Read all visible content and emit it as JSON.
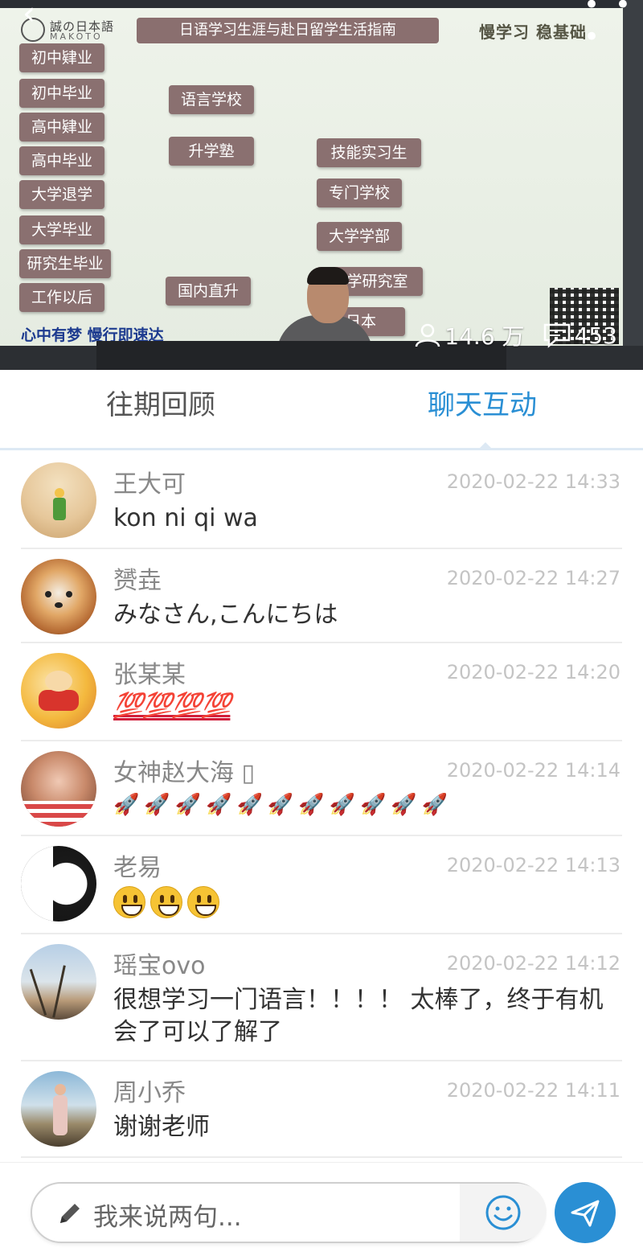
{
  "video": {
    "logo_jp": "誠の日本語",
    "logo_en": "MAKOTO",
    "slide_title": "日语学习生涯与赴日留学生活指南",
    "slide_slogan": "慢学习 稳基础",
    "left_boxes": [
      "初中肄业",
      "初中毕业",
      "高中肄业",
      "高中毕业",
      "大学退学",
      "大学毕业",
      "研究生毕业",
      "工作以后"
    ],
    "middle_boxes": [
      "语言学校",
      "升学塾",
      "国内直升"
    ],
    "right_boxes": [
      "技能实习生",
      "专门学校",
      "大学学部",
      "大学研究室",
      "日本"
    ],
    "motto": "心中有梦  慢行即速达",
    "viewers": "14.6 万",
    "comments": "453"
  },
  "tabs": {
    "history": "往期回顾",
    "chat": "聊天互动",
    "active": "chat"
  },
  "messages": [
    {
      "name": "王大可",
      "time": "2020-02-22 14:33",
      "text": "kon ni qi wa"
    },
    {
      "name": "赟垚",
      "time": "2020-02-22 14:27",
      "text": "みなさん,こんにちは"
    },
    {
      "name": "张某某",
      "time": "2020-02-22 14:20",
      "text": "💯💯💯💯"
    },
    {
      "name": "女神赵大海 ▯",
      "time": "2020-02-22 14:14",
      "text": "🚀🚀🚀🚀🚀🚀🚀🚀🚀🚀🚀"
    },
    {
      "name": "老易",
      "time": "2020-02-22 14:13",
      "text": "😃😃😃"
    },
    {
      "name": "瑶宝ovo",
      "time": "2020-02-22 14:12",
      "text": "很想学习一门语言！！！！ 太棒了，终于有机会了可以了解了"
    },
    {
      "name": "周小乔",
      "time": "2020-02-22 14:11",
      "text": "谢谢老师"
    }
  ],
  "input": {
    "placeholder": "我来说两句..."
  },
  "colors": {
    "accent": "#2a8fd4",
    "slide_box": "#8a7070",
    "motto": "#1d3b8f"
  }
}
